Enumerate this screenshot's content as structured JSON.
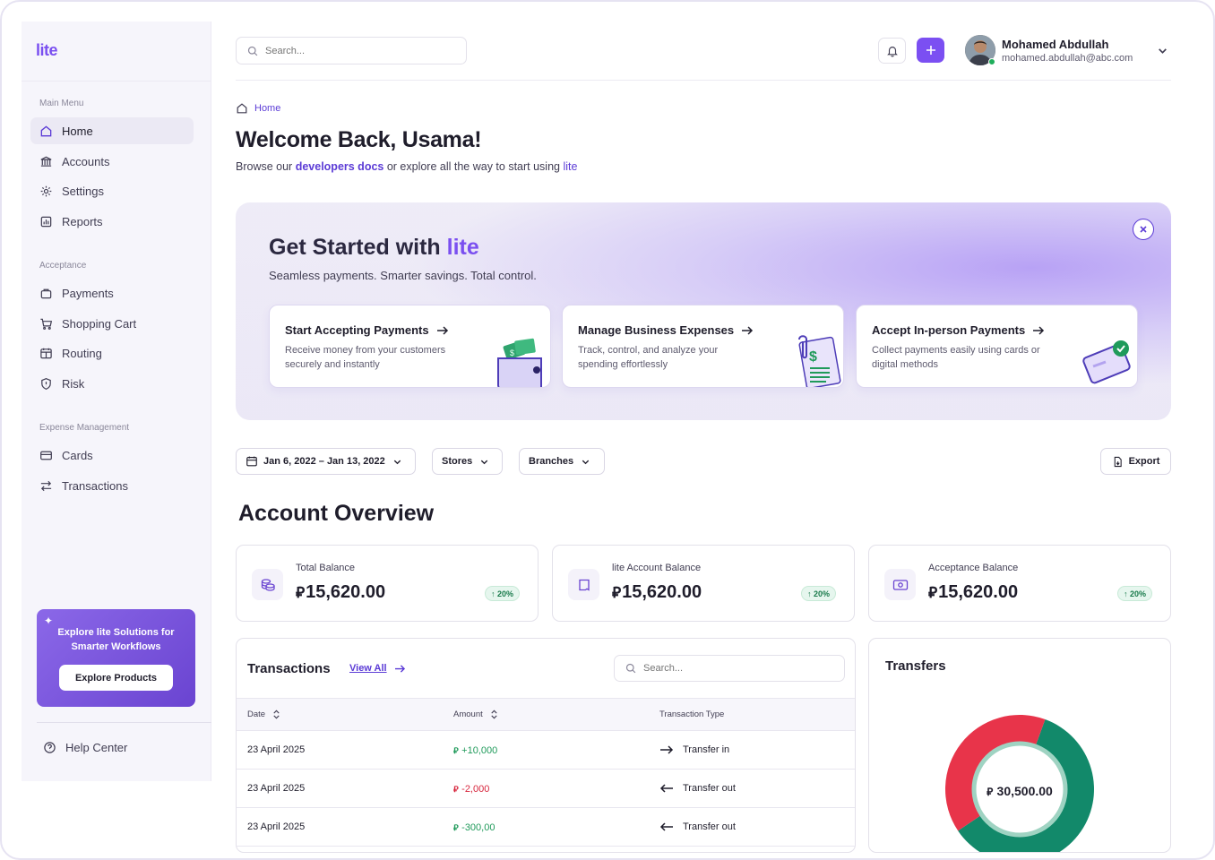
{
  "brand": {
    "logo": "lite",
    "accent": "#7a4ff0"
  },
  "sidebar": {
    "sections": [
      {
        "label": "Main Menu"
      },
      {
        "label": "Acceptance"
      },
      {
        "label": "Expense Management"
      }
    ],
    "items": [
      {
        "label": "Home",
        "icon": "home-icon",
        "active": true
      },
      {
        "label": "Accounts",
        "icon": "bank-icon"
      },
      {
        "label": "Settings",
        "icon": "gear-icon"
      },
      {
        "label": "Reports",
        "icon": "chart-icon"
      },
      {
        "label": "Payments",
        "icon": "bag-icon"
      },
      {
        "label": "Shopping Cart",
        "icon": "cart-icon"
      },
      {
        "label": "Routing",
        "icon": "calendar-icon"
      },
      {
        "label": "Risk",
        "icon": "shield-icon"
      },
      {
        "label": "Cards",
        "icon": "card-icon"
      },
      {
        "label": "Transactions",
        "icon": "swap-icon"
      }
    ],
    "promo": {
      "text": "Explore lite Solutions for Smarter Workflows",
      "button": "Explore Products"
    },
    "help": "Help Center"
  },
  "topbar": {
    "search_placeholder": "Search...",
    "user": {
      "name": "Mohamed Abdullah",
      "email": "mohamed.abdullah@abc.com"
    }
  },
  "page": {
    "breadcrumb": "Home",
    "welcome": "Welcome Back, Usama!",
    "browse": {
      "prefix": "Browse our ",
      "link": "developers docs",
      "middle": " or explore all the way to start using ",
      "brand": "lite"
    }
  },
  "banner": {
    "title_prefix": "Get Started with ",
    "title_brand": "lite",
    "subtitle": "Seamless payments. Smarter savings. Total control.",
    "cards": [
      {
        "title": "Start Accepting Payments",
        "desc": "Receive money from your customers securely and instantly"
      },
      {
        "title": "Manage Business Expenses",
        "desc": "Track, control, and analyze your spending effortlessly"
      },
      {
        "title": "Accept In-person Payments",
        "desc": "Collect payments easily using cards or digital methods"
      }
    ]
  },
  "filters": {
    "date_range": "Jan 6, 2022 – Jan 13, 2022",
    "stores": "Stores",
    "branches": "Branches",
    "export": "Export"
  },
  "overview": {
    "title": "Account Overview",
    "cards": [
      {
        "label": "Total Balance",
        "value": "15,620.00",
        "change": "20%",
        "icon": "coins-icon"
      },
      {
        "label": "lite Account Balance",
        "value": "15,620.00",
        "change": "20%",
        "icon": "book-icon"
      },
      {
        "label": "Acceptance Balance",
        "value": "15,620.00",
        "change": "20%",
        "icon": "cash-icon"
      }
    ]
  },
  "transactions": {
    "title": "Transactions",
    "view_all": "View All",
    "search_placeholder": "Search...",
    "columns": [
      "Date",
      "Amount",
      "Transaction Type"
    ],
    "rows": [
      {
        "date": "23 April 2025",
        "amount": "+10,000",
        "sign": "pos",
        "type": "Transfer in",
        "dir": "in"
      },
      {
        "date": "23 April 2025",
        "amount": "-2,000",
        "sign": "neg",
        "type": "Transfer out",
        "dir": "out"
      },
      {
        "date": "23 April 2025",
        "amount": "-300,00",
        "sign": "pos",
        "type": "Transfer out",
        "dir": "out"
      }
    ]
  },
  "transfers": {
    "title": "Transfers",
    "total": "30,500.00",
    "segments": [
      {
        "share": 0.6,
        "color": "#12896a"
      },
      {
        "share": 0.4,
        "color": "#e8344a"
      }
    ]
  }
}
